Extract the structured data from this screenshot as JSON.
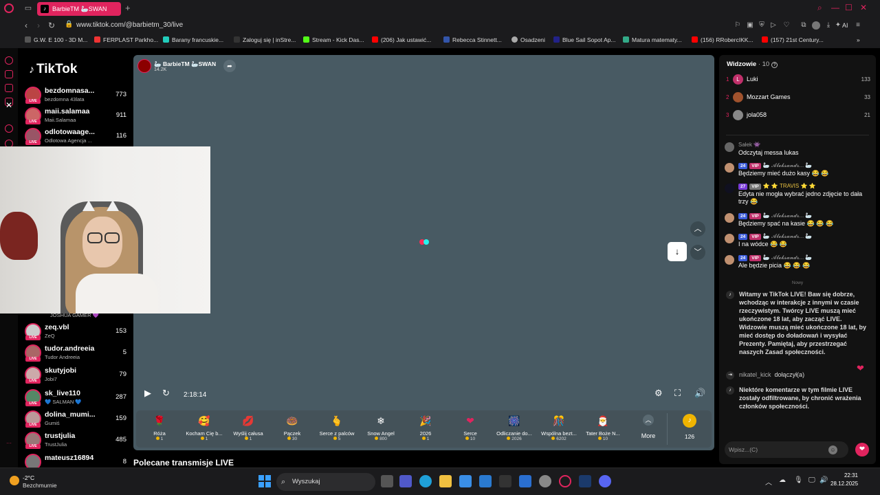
{
  "browser": {
    "tab_title": "BarbieTM 🦢SWAN",
    "url": "www.tiktok.com/@barbietm_30/live",
    "ai_label": "AI",
    "bookmarks": [
      "G.W. E 100 - 3D M...",
      "FERPLAST Parkho...",
      "Barany francuskie...",
      "Zaloguj się | inStre...",
      "Stream - Kick Das...",
      "(206) Jak ustawić...",
      "Rebecca Stinnett...",
      "Osadzeni",
      "Blue Sail Sopot Ap...",
      "Matura matematy...",
      "(156) RRobercIKK...",
      "(157) 21st Century..."
    ]
  },
  "tiktok": {
    "logo": "TikTok",
    "following": [
      {
        "name": "bezdomnasa...",
        "sub": "bezdomna 43lata",
        "count": "773"
      },
      {
        "name": "maii.salamaa",
        "sub": "Maii.Salamaa",
        "count": "911"
      },
      {
        "name": "odlotowaage...",
        "sub": "Odlotowa Agencja ...",
        "count": "116"
      },
      {
        "name": "zeq.vbl",
        "sub": "ZeQ",
        "count": "153"
      },
      {
        "name": "tudor.andreeia",
        "sub": "Tudor Andreeia",
        "count": "5"
      },
      {
        "name": "skutyjobi",
        "sub": "Jobi7",
        "count": "79"
      },
      {
        "name": "sk_live110",
        "sub": "💙 SALMAN 💙",
        "count": "287"
      },
      {
        "name": "dolina_mumi...",
        "sub": "Gumiś",
        "count": "159"
      },
      {
        "name": "trustjulia",
        "sub": "TrustJulia",
        "count": "485"
      },
      {
        "name": "mateusz16894",
        "sub": "",
        "count": "8"
      }
    ],
    "partial_sub": "JOSHUA GAMER 💜",
    "live_tag": "LIVE"
  },
  "player": {
    "streamer_name": "🦢 BarbieTM 🦢SWAN",
    "likes": "14.2K",
    "time": "2:18:14",
    "gifts": [
      {
        "name": "Róża",
        "price": "1",
        "icon": "🌹",
        "color": "#e0245e"
      },
      {
        "name": "Kocham Cię b...",
        "price": "1",
        "icon": "🥰",
        "color": "#f0a020"
      },
      {
        "name": "Wyślij całusa",
        "price": "1",
        "icon": "💋",
        "color": "#e0245e"
      },
      {
        "name": "Pączek",
        "price": "30",
        "icon": "🍩",
        "color": "#f0c0d0"
      },
      {
        "name": "Serce z palców",
        "price": "5",
        "icon": "🫰",
        "color": "#f0a070"
      },
      {
        "name": "Snow Angel",
        "price": "800",
        "icon": "❄",
        "color": "#aab"
      },
      {
        "name": "2026",
        "price": "1",
        "icon": "🎉",
        "color": "#a0c0ff"
      },
      {
        "name": "Serce",
        "price": "10",
        "icon": "❤",
        "color": "#e0245e"
      },
      {
        "name": "Odliczanie do...",
        "price": "2026",
        "icon": "🎆",
        "color": "#a060e0"
      },
      {
        "name": "Wspólna bezt...",
        "price": "6202",
        "icon": "🎊",
        "color": "#e060a0"
      },
      {
        "name": "Tater Boże N...",
        "price": "10",
        "icon": "🎅",
        "color": "#60a060"
      }
    ],
    "more_label": "More",
    "coins": "126"
  },
  "recommended_heading": "Polecane transmisje LIVE",
  "chat": {
    "viewers_label": "Widzowie",
    "viewers_count": "· 10",
    "top_viewers": [
      {
        "rank": "1",
        "name": "Luki",
        "score": "133",
        "avatar_color": "#c0306a",
        "initial": "L"
      },
      {
        "rank": "2",
        "name": "Mozzart Games",
        "score": "33",
        "avatar_color": "#a0522d",
        "initial": ""
      },
      {
        "rank": "3",
        "name": "jola058",
        "score": "21",
        "avatar_color": "#888",
        "initial": ""
      }
    ],
    "messages": [
      {
        "user": "Sałek 👾",
        "text": "Odczytaj messa lukas",
        "badges": [],
        "avatar": "#666"
      },
      {
        "user": "🦢 𝓐𝓵𝓮𝓴𝓼𝓪𝓷𝓭𝓻... 🦢",
        "text": "Będziemy mieć dużo kasy 😂 😂",
        "badges": [
          "24",
          "VIP"
        ],
        "avatar": "#c09070"
      },
      {
        "user": "⭐ ⭐ TRAVIS ⭐ ⭐",
        "text": "Edyta nie mogła wybrać jedno zdjęcie to dała trzy 😂",
        "badges": [
          "27",
          "VIP"
        ],
        "avatar": "#101020"
      },
      {
        "user": "🦢 𝓐𝓵𝓮𝓴𝓼𝓪𝓷𝓭𝓻... 🦢",
        "text": "Będziemy spać na kasie 😂 😂 😂",
        "badges": [
          "24",
          "VIP"
        ],
        "avatar": "#c09070"
      },
      {
        "user": "🦢 𝓐𝓵𝓮𝓴𝓼𝓪𝓷𝓭𝓻... 🦢",
        "text": "I na wódce 😂 😂",
        "badges": [
          "24",
          "VIP"
        ],
        "avatar": "#c09070"
      },
      {
        "user": "🦢 𝓐𝓵𝓮𝓴𝓼𝓪𝓷𝓭𝓻... 🦢",
        "text": "Ale będzie picia 😂 😂 😂",
        "badges": [
          "24",
          "VIP"
        ],
        "avatar": "#c09070"
      }
    ],
    "new_separator": "Nowy",
    "welcome": "Witamy w TikTok LIVE! Baw się dobrze, wchodząc w interakcje z innymi w czasie rzeczywistym. Twórcy LIVE muszą mieć ukończone 18 lat, aby zacząć LIVE. Widzowie muszą mieć ukończone 18 lat, by mieć dostęp do doładowań i wysyłać Prezenty. Pamiętaj, aby przestrzegać naszych Zasad społeczności.",
    "join_user": "nikatel_kick",
    "join_text": "dołączył(a)",
    "filter_notice": "Niektóre komentarze w tym filmie LIVE zostały odfiltrowane, by chronić wrażenia członków społeczności.",
    "input_placeholder": "Wpisz...(C)"
  },
  "taskbar": {
    "temp": "-2°C",
    "weather": "Bezchmurnie",
    "search": "Wyszukaj",
    "time": "22:31",
    "date": "28.12.2025"
  },
  "colors": {
    "accent": "#e0245e",
    "player_bg": "#485a63",
    "gift_bar": "#445259"
  }
}
